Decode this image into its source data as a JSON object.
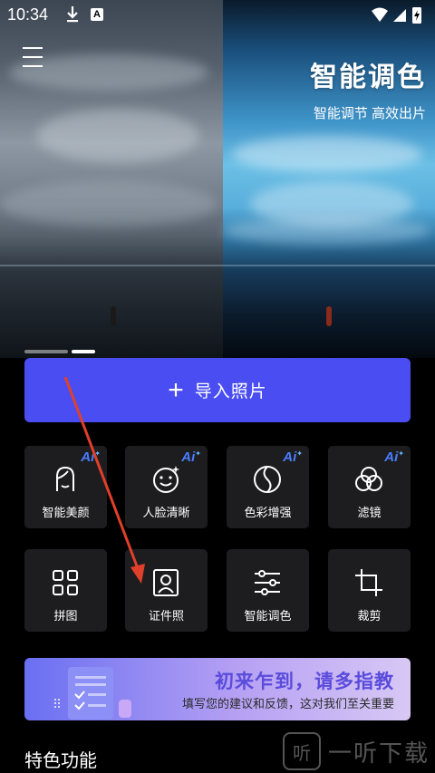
{
  "status_bar": {
    "time": "10:34",
    "keyboard_badge": "A"
  },
  "hero": {
    "title": "智能调色",
    "subtitle": "智能调节 高效出片",
    "pager_active_index": 1
  },
  "import_button": {
    "label": "导入照片"
  },
  "tools": [
    {
      "label": "智能美颜",
      "icon": "face-beauty-icon",
      "ai": true
    },
    {
      "label": "人脸清晰",
      "icon": "face-clarity-icon",
      "ai": true
    },
    {
      "label": "色彩增强",
      "icon": "color-enhance-icon",
      "ai": true
    },
    {
      "label": "滤镜",
      "icon": "filter-icon",
      "ai": true
    },
    {
      "label": "拼图",
      "icon": "collage-grid-icon",
      "ai": false
    },
    {
      "label": "证件照",
      "icon": "id-photo-icon",
      "ai": false
    },
    {
      "label": "智能调色",
      "icon": "adjust-sliders-icon",
      "ai": false
    },
    {
      "label": "裁剪",
      "icon": "crop-icon",
      "ai": false
    }
  ],
  "ai_badge": "Ai",
  "banner": {
    "title": "初来乍到，请多指教",
    "subtitle": "填写您的建议和反馈，这对我们至关重要"
  },
  "section_title": "特色功能",
  "watermark": {
    "logo": "听",
    "text": "一听下载"
  },
  "colors": {
    "accent": "#4a4ef2",
    "tile": "#1d1d1f",
    "ai": "#4a7cff",
    "arrow": "#e0402a"
  }
}
